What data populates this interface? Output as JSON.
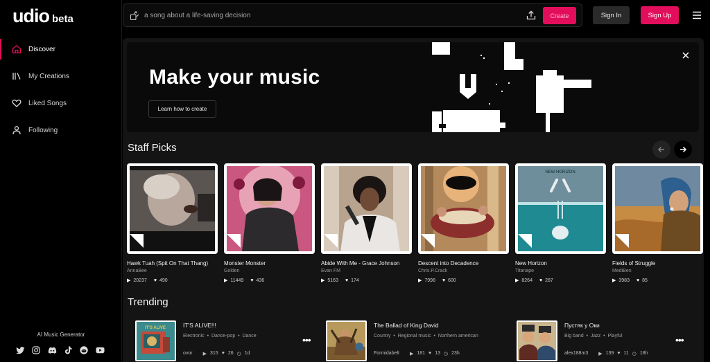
{
  "brand": {
    "name": "udio",
    "badge": "beta"
  },
  "sidebar": {
    "items": [
      {
        "label": "Discover",
        "icon": "home-icon",
        "active": true
      },
      {
        "label": "My Creations",
        "icon": "library-icon",
        "active": false
      },
      {
        "label": "Liked Songs",
        "icon": "heart-icon",
        "active": false
      },
      {
        "label": "Following",
        "icon": "user-icon",
        "active": false
      }
    ],
    "tagline": "AI Music Generator",
    "socials": [
      "twitter-icon",
      "instagram-icon",
      "discord-icon",
      "tiktok-icon",
      "reddit-icon",
      "youtube-icon"
    ]
  },
  "topbar": {
    "search_placeholder": "a song about a life-saving decision",
    "create_label": "Create",
    "signin_label": "Sign In",
    "signup_label": "Sign Up"
  },
  "hero": {
    "title": "Make your music",
    "button_label": "Learn how to create"
  },
  "staff_picks": {
    "title": "Staff Picks",
    "items": [
      {
        "title": "Hawk Tuah (Spit On That Thang)",
        "artist": "AnnaBee",
        "plays": "20237",
        "likes": "490"
      },
      {
        "title": "Monster Monster",
        "artist": "Golden",
        "plays": "11449",
        "likes": "436"
      },
      {
        "title": "Abide With Me - Grace Johnson",
        "artist": "Evan FM",
        "plays": "5163",
        "likes": "174"
      },
      {
        "title": "Descent into Decadence",
        "artist": "Chris.P.Crack",
        "plays": "7998",
        "likes": "600"
      },
      {
        "title": "New Horizon",
        "artist": "Titanape",
        "plays": "8264",
        "likes": "287",
        "cover_text": "NEW HORIZON"
      },
      {
        "title": "Fields of Struggle",
        "artist": "MediBen",
        "plays": "3983",
        "likes": "85"
      }
    ]
  },
  "trending": {
    "title": "Trending",
    "items": [
      {
        "title": "IT'S ALIVE!!!",
        "tags": [
          "Electronic",
          "Dance-pop",
          "Dance"
        ],
        "artist": "ovor",
        "plays": "315",
        "likes": "26",
        "age": "1d",
        "cover_text": "IT'S ALIVE"
      },
      {
        "title": "The Ballad of King David",
        "tags": [
          "Country",
          "Regional music",
          "Northern american"
        ],
        "artist": "Formidabelt",
        "plays": "181",
        "likes": "13",
        "age": "23h"
      },
      {
        "title": "Пустяк у Оки",
        "tags": [
          "Big band",
          "Jazz",
          "Playful"
        ],
        "artist": "alex188m3",
        "plays": "139",
        "likes": "11",
        "age": "18h"
      }
    ]
  },
  "colors": {
    "accent": "#e30e5b",
    "background": "#000000",
    "panel": "#141414"
  }
}
